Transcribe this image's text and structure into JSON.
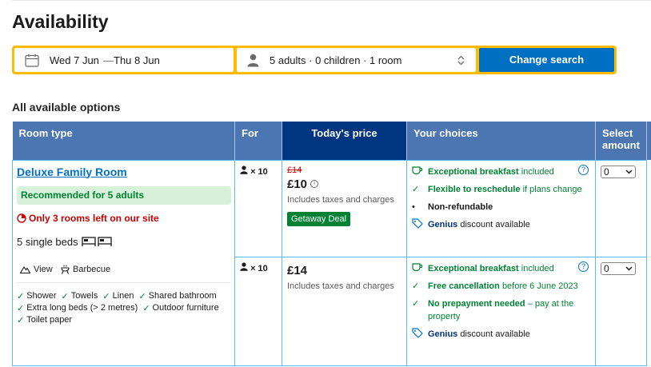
{
  "page": {
    "title": "Availability"
  },
  "search": {
    "checkin": "Wed 7 Jun",
    "dash": "—",
    "checkout": "Thu 8 Jun",
    "guests": "5 adults · 0 children · 1 room",
    "button_label": "Change search"
  },
  "options": {
    "title": "All available options",
    "headers": {
      "room_type": "Room type",
      "for": "For",
      "price": "Today's price",
      "choices": "Your choices",
      "select": "Select",
      "amount": "amount"
    }
  },
  "room": {
    "name": "Deluxe Family Room",
    "recommended": "Recommended for 5 adults",
    "scarcity": "Only 3 rooms left on our site",
    "beds": "5 single beds",
    "features": [
      {
        "label": "View",
        "icon": "mountain-icon"
      },
      {
        "label": "Barbecue",
        "icon": "barbecue-icon"
      }
    ],
    "amenities": [
      "Shower",
      "Towels",
      "Linen",
      "Shared bathroom",
      "Extra long beds (> 2 metres)",
      "Outdoor furniture",
      "Toilet paper"
    ]
  },
  "rates": [
    {
      "occupancy": "× 10",
      "old_price": "£14",
      "price": "£10",
      "taxes": "Includes taxes and charges",
      "deal": "Getaway Deal",
      "choices": {
        "breakfast_bold": "Exceptional breakfast",
        "breakfast_rest": "included",
        "policy_bold": "Flexible to reschedule",
        "policy_rest": "if plans change",
        "refund": "Non-refundable",
        "genius": "Genius",
        "genius_rest": "discount available"
      },
      "amount": "0"
    },
    {
      "occupancy": "× 10",
      "price": "£14",
      "taxes": "Includes taxes and charges",
      "choices": {
        "breakfast_bold": "Exceptional breakfast",
        "breakfast_rest": "included",
        "policy_bold": "Free cancellation",
        "policy_rest": "before 6 June 2023",
        "prepay_bold": "No prepayment needed",
        "prepay_rest": "– pay at the property",
        "genius": "Genius",
        "genius_rest": "discount available"
      },
      "amount": "0"
    }
  ],
  "colors": {
    "accent": "#0071c2",
    "header": "#4c76b2",
    "price_header": "#003580",
    "search_border": "#febb02",
    "green": "#008234",
    "red": "#cc0000"
  }
}
